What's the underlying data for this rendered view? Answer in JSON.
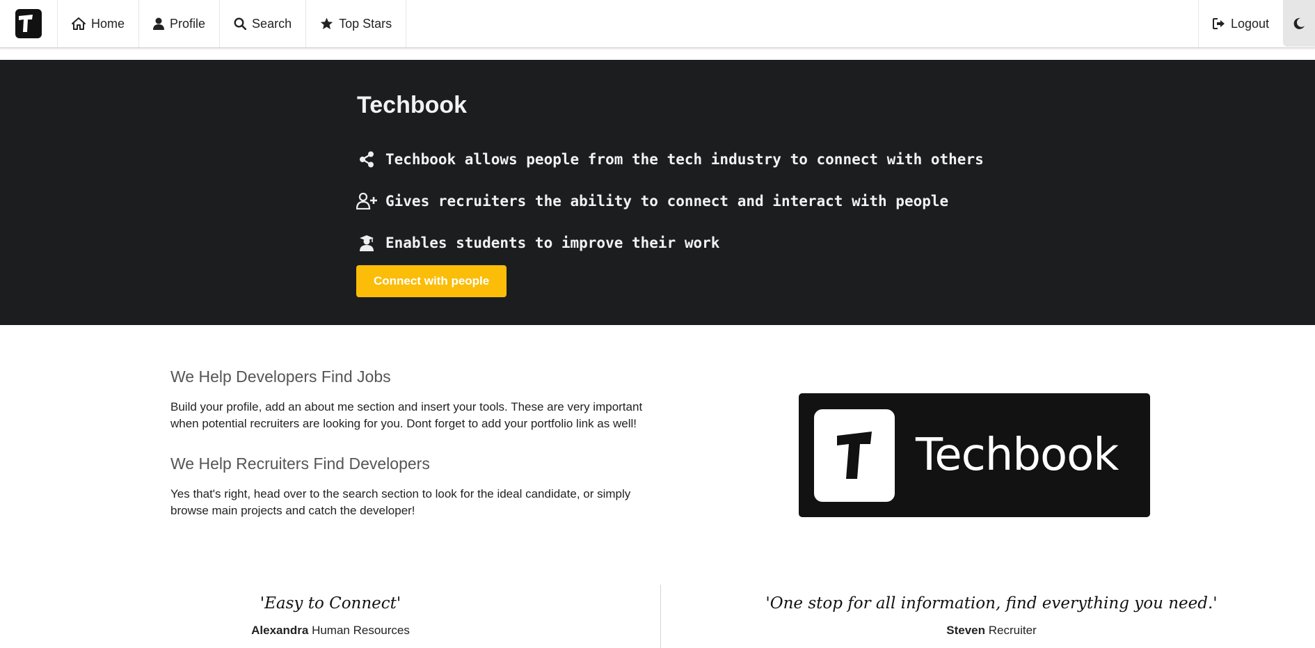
{
  "nav": {
    "items": [
      {
        "label": "Home",
        "icon": "home-icon"
      },
      {
        "label": "Profile",
        "icon": "user-icon"
      },
      {
        "label": "Search",
        "icon": "search-icon"
      },
      {
        "label": "Top Stars",
        "icon": "star-icon"
      }
    ],
    "logout_label": "Logout",
    "logo_letter": "T"
  },
  "hero": {
    "title": "Techbook",
    "features": [
      {
        "text": "Techbook allows people from the tech industry to connect with others",
        "icon": "share-icon"
      },
      {
        "text": "Gives recruiters the ability to connect and interact with people",
        "icon": "user-plus-icon"
      },
      {
        "text": "Enables students to improve their work",
        "icon": "graduate-icon"
      }
    ],
    "button_label": "Connect with people",
    "accent": "#fbbd08"
  },
  "about": {
    "heading1": "We Help Developers Find Jobs",
    "text1": "Build your profile, add an about me section and insert your tools. These are very important when potential recruiters are looking for you. Dont forget to add your portfolio link as well!",
    "heading2": "We Help Recruiters Find Developers",
    "text2": "Yes that's right, head over to the search section to look for the ideal candidate, or simply browse main projects and catch the developer!"
  },
  "brand": {
    "wordmark": "Techbook",
    "logo_letter": "T"
  },
  "testimonials": [
    {
      "quote": "'Easy to Connect'",
      "name": "Alexandra",
      "role": "Human Resources"
    },
    {
      "quote": "'One stop for all information, find everything you need.'",
      "name": "Steven",
      "role": "Recruiter"
    }
  ]
}
